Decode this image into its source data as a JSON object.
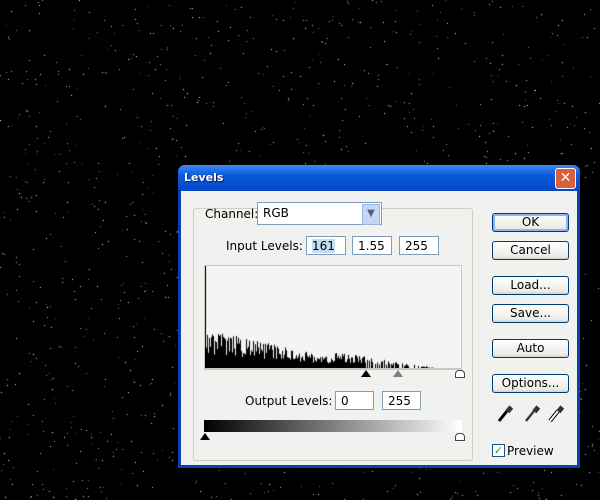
{
  "dialog": {
    "title": "Levels",
    "close_label": "✕"
  },
  "channel": {
    "label": "Channel:",
    "value": "RGB"
  },
  "input_levels": {
    "label": "Input Levels:",
    "black": "161",
    "gamma": "1.55",
    "white": "255"
  },
  "output_levels": {
    "label": "Output Levels:",
    "black": "0",
    "white": "255"
  },
  "buttons": {
    "ok": "OK",
    "cancel": "Cancel",
    "load": "Load...",
    "save": "Save...",
    "auto": "Auto",
    "options": "Options..."
  },
  "preview": {
    "label": "Preview",
    "checked": true
  },
  "eyedroppers": [
    "black-point-eyedropper",
    "gray-point-eyedropper",
    "white-point-eyedropper"
  ],
  "colors": {
    "title_bar": "#0a5ad8",
    "dialog_bg": "#f1f1ef"
  }
}
